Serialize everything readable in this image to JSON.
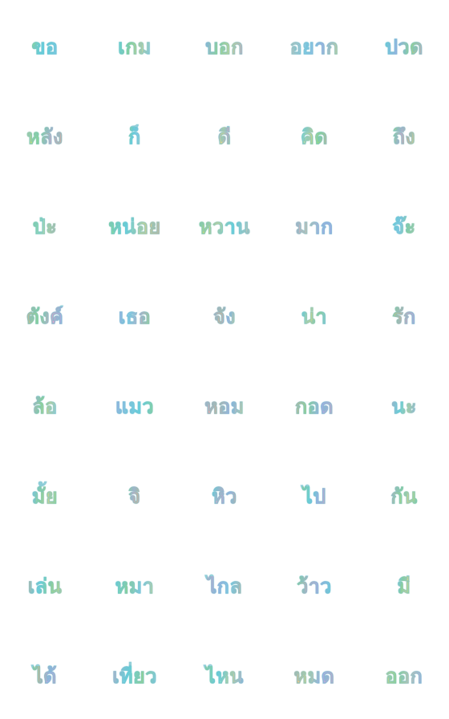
{
  "sticker_grid": {
    "rows": 8,
    "columns": 5,
    "palette": [
      "#9be36f",
      "#5fdde8",
      "#f2a3c4",
      "#f7e07a",
      "#b9a6f0",
      "#f5b08a",
      "#8fd0f5",
      "#a7e8b8"
    ],
    "items": [
      {
        "text": "ขอ",
        "colors": [
          "#a8e06c",
          "#5fdde8",
          "#62d6e6",
          "#8fd0f5"
        ]
      },
      {
        "text": "เกม",
        "colors": [
          "#5fdde8",
          "#9be36f",
          "#f7e07a",
          "#8fd0f5"
        ]
      },
      {
        "text": "บอก",
        "colors": [
          "#b9a6f0",
          "#a8e06c",
          "#f7e07a",
          "#f2a3c4"
        ]
      },
      {
        "text": "อยาก",
        "colors": [
          "#f5c6a8",
          "#8fd0f5",
          "#b9a6f0",
          "#f7e07a"
        ]
      },
      {
        "text": "ปวด",
        "colors": [
          "#5fdde8",
          "#b9a6f0",
          "#a8e06c",
          "#f2a3c4"
        ]
      },
      {
        "text": "หลัง",
        "colors": [
          "#f7e07a",
          "#9be36f",
          "#f2a3c4",
          "#f5b08a"
        ]
      },
      {
        "text": "ก็",
        "colors": [
          "#a8e06c",
          "#5fdde8",
          "#8fd0f5",
          "#a7e8b8"
        ]
      },
      {
        "text": "ดี",
        "colors": [
          "#b9a6f0",
          "#f7e07a",
          "#f2a3c4",
          "#a8e06c"
        ]
      },
      {
        "text": "คิด",
        "colors": [
          "#5fdde8",
          "#f7e07a",
          "#9be36f",
          "#f5b08a"
        ]
      },
      {
        "text": "ถึง",
        "colors": [
          "#9be36f",
          "#f2a3c4",
          "#f5b08a",
          "#f7e07a"
        ]
      },
      {
        "text": "ป่ะ",
        "colors": [
          "#9be36f",
          "#a7e8b8",
          "#f7e07a",
          "#f5b08a"
        ]
      },
      {
        "text": "หน่อย",
        "colors": [
          "#9be36f",
          "#5fdde8",
          "#f7e07a",
          "#f5b08a"
        ]
      },
      {
        "text": "หวาน",
        "colors": [
          "#a8e06c",
          "#f7e07a",
          "#5fdde8",
          "#f5c6a8"
        ]
      },
      {
        "text": "มาก",
        "colors": [
          "#f2a3c4",
          "#f5c6a8",
          "#b9a6f0",
          "#b9a6f0"
        ]
      },
      {
        "text": "จ๊ะ",
        "colors": [
          "#5fdde8",
          "#8fd0f5",
          "#a8e06c",
          "#f7e07a"
        ]
      },
      {
        "text": "ตังค์",
        "colors": [
          "#f5b08a",
          "#9be36f",
          "#f2a3c4",
          "#b9a6f0"
        ]
      },
      {
        "text": "เธอ",
        "colors": [
          "#b9a6f0",
          "#8fd0f5",
          "#f2a3c4",
          "#a8e06c"
        ]
      },
      {
        "text": "จัง",
        "colors": [
          "#f2a3c4",
          "#f5b08a",
          "#b9a6f0",
          "#f7e07a"
        ]
      },
      {
        "text": "น่า",
        "colors": [
          "#5fdde8",
          "#f7e07a",
          "#a8e06c",
          "#8fd0f5"
        ]
      },
      {
        "text": "รัก",
        "colors": [
          "#a8e06c",
          "#f5b08a",
          "#f2a3c4",
          "#b9a6f0"
        ]
      },
      {
        "text": "ล้อ",
        "colors": [
          "#f2a3c4",
          "#a8e06c",
          "#f7e07a",
          "#8fd0f5"
        ]
      },
      {
        "text": "แมว",
        "colors": [
          "#b9a6f0",
          "#8fd0f5",
          "#5fdde8",
          "#a8e06c"
        ]
      },
      {
        "text": "หอม",
        "colors": [
          "#f2a3c4",
          "#f5b08a",
          "#b9a6f0",
          "#f7e07a"
        ]
      },
      {
        "text": "กอด",
        "colors": [
          "#f5b08a",
          "#a8e06c",
          "#b9a6f0",
          "#f2a3c4"
        ]
      },
      {
        "text": "นะ",
        "colors": [
          "#f2a3c4",
          "#5fdde8",
          "#f7e07a",
          "#b9a6f0"
        ]
      },
      {
        "text": "มั้ย",
        "colors": [
          "#8fd0f5",
          "#a8e06c",
          "#f7e07a",
          "#9be36f"
        ]
      },
      {
        "text": "จิ",
        "colors": [
          "#9be36f",
          "#f2a3c4",
          "#f5b08a",
          "#f2a3c4"
        ]
      },
      {
        "text": "หิว",
        "colors": [
          "#5fdde8",
          "#f2a3c4",
          "#b9a6f0",
          "#f5b08a"
        ]
      },
      {
        "text": "ไป",
        "colors": [
          "#a8e06c",
          "#5fdde8",
          "#b9a6f0",
          "#f2a3c4"
        ]
      },
      {
        "text": "กัน",
        "colors": [
          "#f2a3c4",
          "#a8e06c",
          "#f7e07a",
          "#9be36f"
        ]
      },
      {
        "text": "เล่น",
        "colors": [
          "#f5b08a",
          "#5fdde8",
          "#a8e06c",
          "#f7e07a"
        ]
      },
      {
        "text": "หมา",
        "colors": [
          "#5fdde8",
          "#a8e06c",
          "#8fd0f5",
          "#f7e07a"
        ]
      },
      {
        "text": "ไกล",
        "colors": [
          "#f2a3c4",
          "#b9a6f0",
          "#8fd0f5",
          "#f5b08a"
        ]
      },
      {
        "text": "ว้าว",
        "colors": [
          "#9be36f",
          "#f2a3c4",
          "#b9a6f0",
          "#5fdde8"
        ]
      },
      {
        "text": "มี",
        "colors": [
          "#8fd0f5",
          "#a8e06c",
          "#f7e07a",
          "#9be36f"
        ]
      },
      {
        "text": "ได้",
        "colors": [
          "#a8e06c",
          "#f5b08a",
          "#b9a6f0",
          "#f2a3c4"
        ]
      },
      {
        "text": "เที่ยว",
        "colors": [
          "#f2a3c4",
          "#5fdde8",
          "#a8e06c",
          "#8fd0f5"
        ]
      },
      {
        "text": "ไหน",
        "colors": [
          "#a8e06c",
          "#5fdde8",
          "#f7e07a",
          "#b9a6f0"
        ]
      },
      {
        "text": "หมด",
        "colors": [
          "#f5b08a",
          "#f7e07a",
          "#b9a6f0",
          "#f2a3c4"
        ]
      },
      {
        "text": "ออก",
        "colors": [
          "#f7e07a",
          "#a8e06c",
          "#f5c6a8",
          "#b9a6f0"
        ]
      }
    ]
  }
}
